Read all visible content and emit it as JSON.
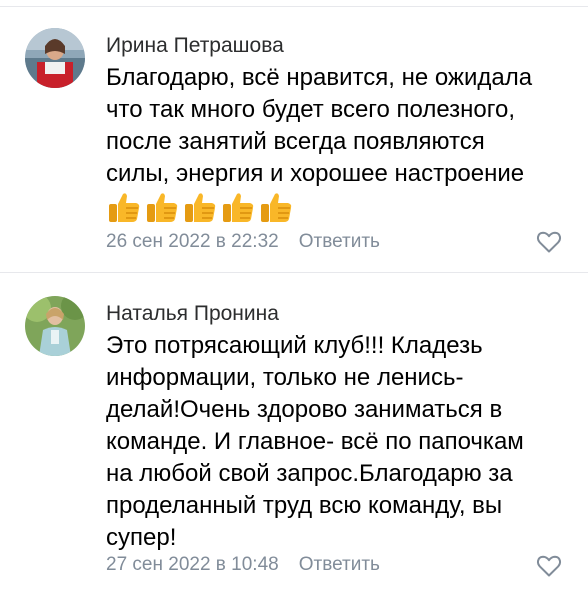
{
  "comments": [
    {
      "author": "Ирина Петрашова",
      "lines": [
        "Благодарю, всё нравится, не ожидала",
        "что так много будет всего полезного,",
        "после занятий всегда появляются",
        "силы, энергия и хорошее настроение"
      ],
      "emojis": [
        "thumbs-up",
        "thumbs-up",
        "thumbs-up",
        "thumbs-up",
        "thumbs-up"
      ],
      "date": "26 сен 2022 в 22:32",
      "reply_label": "Ответить"
    },
    {
      "author": "Наталья Пронина",
      "lines": [
        "Это потрясающий клуб!!! Кладезь",
        "информации, только не ленись-",
        "делай!Очень здорово заниматься в",
        "команде. И главное- всё по папочкам",
        "на любой свой запрос.Благодарю за",
        "проделанный труд всю команду, вы",
        "супер!"
      ],
      "date": "27 сен 2022 в 10:48",
      "reply_label": "Ответить"
    }
  ],
  "icons": {
    "like": "heart-outline-icon",
    "emoji": "thumbs-up-icon"
  },
  "colors": {
    "text": "#000000",
    "author": "#2c2d2e",
    "meta": "#818c99",
    "divider": "#e7e8ec",
    "emoji": "#f9b728"
  }
}
